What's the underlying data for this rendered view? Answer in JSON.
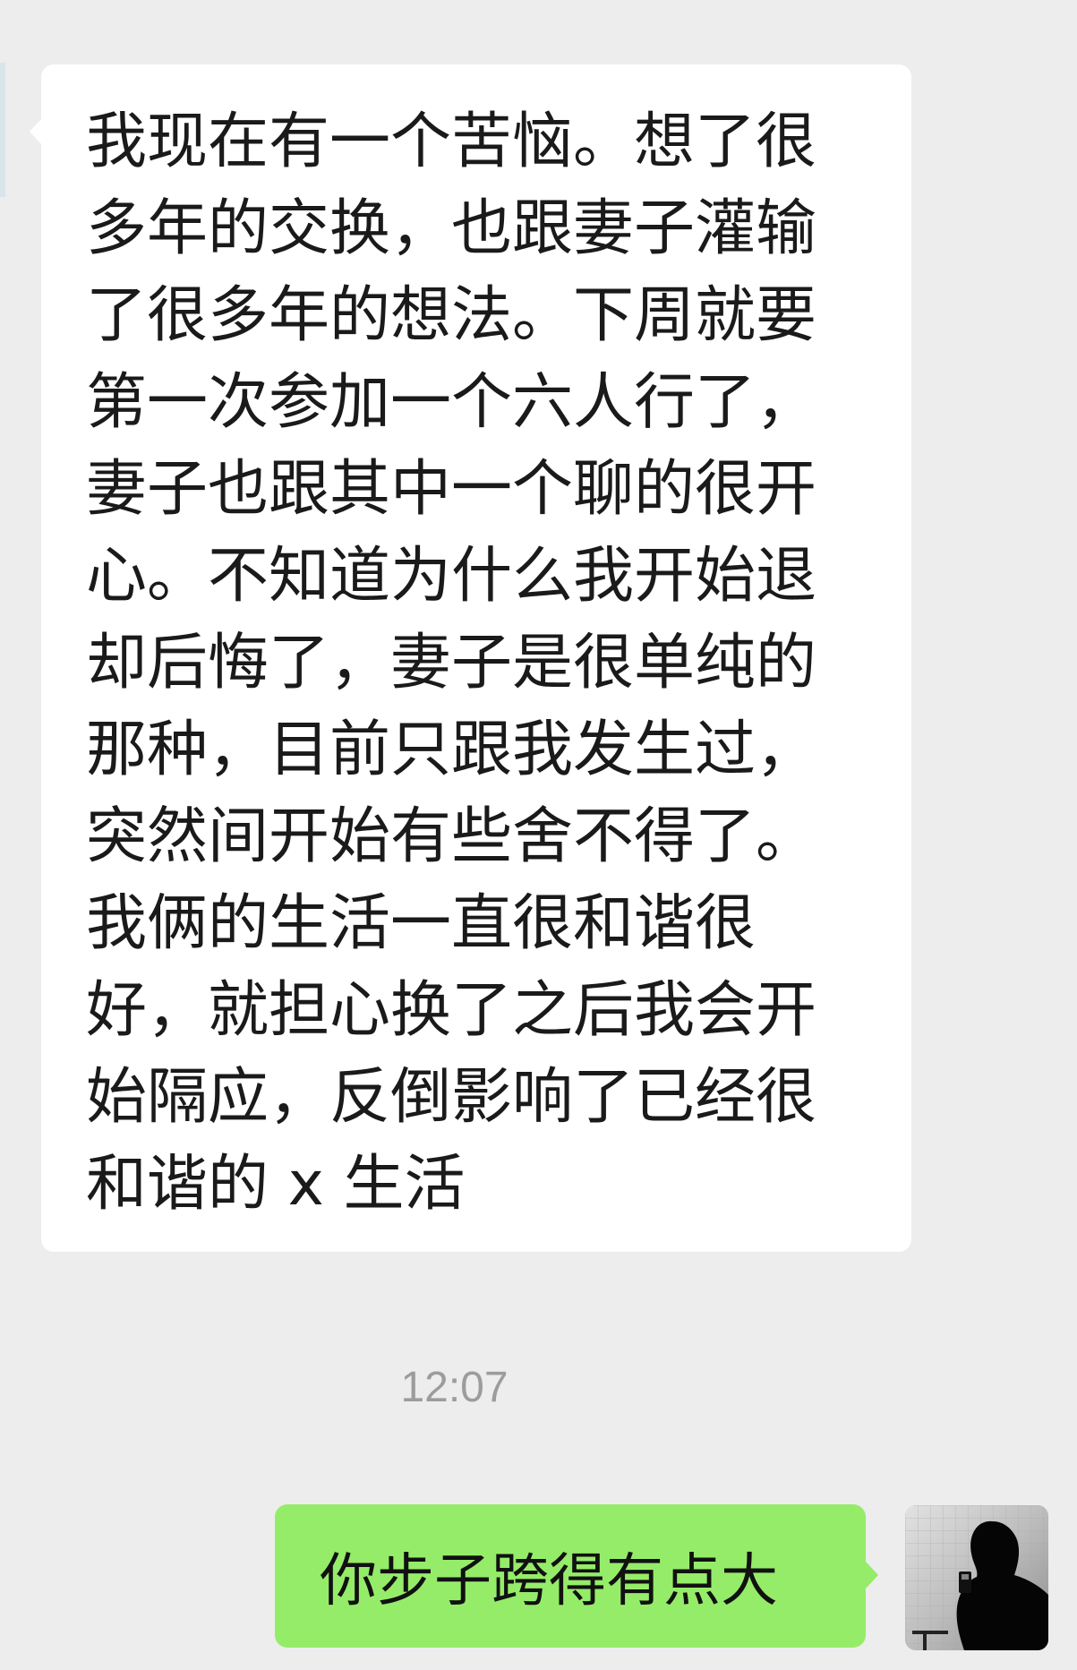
{
  "chat": {
    "incoming_message": "我现在有一个苦恼。想了很多年的交换，也跟妻子灌输了很多年的想法。下周就要第一次参加一个六人行了，妻子也跟其中一个聊的很开心。不知道为什么我开始退却后悔了，妻子是很单纯的那种，目前只跟我发生过，突然间开始有些舍不得了。我俩的生活一直很和谐很好，就担心换了之后我会开始隔应，反倒影响了已经很和谐的 x 生活",
    "timestamp": "12:07",
    "outgoing_message": "你步子跨得有点大"
  },
  "colors": {
    "background": "#ededed",
    "incoming_bubble": "#ffffff",
    "outgoing_bubble": "#95ec69",
    "timestamp_text": "#9c9c9c"
  },
  "icons": {
    "avatar": "user-avatar-silhouette"
  }
}
